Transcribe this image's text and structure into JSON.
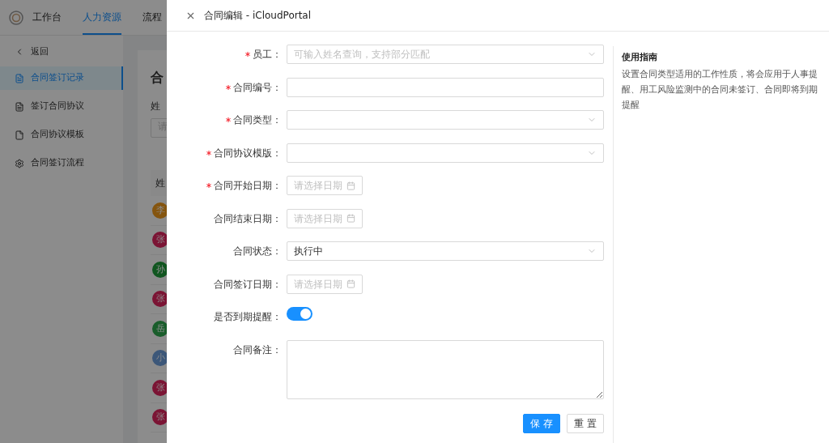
{
  "top_nav": {
    "tabs": [
      {
        "label": "工作台",
        "selected": false
      },
      {
        "label": "人力资源",
        "selected": true
      },
      {
        "label": "流程",
        "selected": false
      }
    ]
  },
  "sidebar": {
    "back": "返回",
    "items": [
      {
        "label": "合同签订记录",
        "selected": true
      },
      {
        "label": "签订合同协议",
        "selected": false
      },
      {
        "label": "合同协议模板",
        "selected": false
      },
      {
        "label": "合同签订流程",
        "selected": false
      }
    ]
  },
  "content": {
    "title": "合",
    "filter_label": "姓",
    "filter_placeholder": "请",
    "table_header": "姓",
    "avatars": [
      {
        "text": "李",
        "color": "#85550f"
      },
      {
        "text": "张",
        "color": "#7b1434"
      },
      {
        "text": "孙",
        "color": "#115620"
      },
      {
        "text": "张",
        "color": "#7b1434"
      },
      {
        "text": "岳",
        "color": "#195d2b"
      },
      {
        "text": "小",
        "color": "#3c5779"
      },
      {
        "text": "张",
        "color": "#7b1434"
      },
      {
        "text": "张",
        "color": "#7b1434"
      }
    ]
  },
  "drawer": {
    "title": "合同编辑 - iCloudPortal",
    "fields": [
      {
        "kind": "select",
        "label": "员工：",
        "required": true,
        "placeholder": "可输入姓名查询，支持部分匹配"
      },
      {
        "kind": "input",
        "label": "合同编号：",
        "required": true
      },
      {
        "kind": "select",
        "label": "合同类型：",
        "required": true
      },
      {
        "kind": "select",
        "label": "合同协议模版：",
        "required": true
      },
      {
        "kind": "date",
        "label": "合同开始日期：",
        "required": true,
        "placeholder": "请选择日期"
      },
      {
        "kind": "date",
        "label": "合同结束日期：",
        "required": false,
        "placeholder": "请选择日期"
      },
      {
        "kind": "select",
        "label": "合同状态：",
        "required": false,
        "value": "执行中"
      },
      {
        "kind": "date",
        "label": "合同签订日期：",
        "required": false,
        "placeholder": "请选择日期"
      },
      {
        "kind": "switch",
        "label": "是否到期提醒：",
        "required": false,
        "on": true
      },
      {
        "kind": "textarea",
        "label": "合同备注：",
        "required": false
      }
    ],
    "buttons": [
      {
        "label": "保 存",
        "kind": "primary"
      },
      {
        "label": "重 置",
        "kind": "default"
      }
    ],
    "guide": {
      "title": "使用指南",
      "text": "设置合同类型适用的工作性质，将会应用于人事提醒、用工风险监测中的合同未签订、合同即将到期提醒"
    }
  }
}
